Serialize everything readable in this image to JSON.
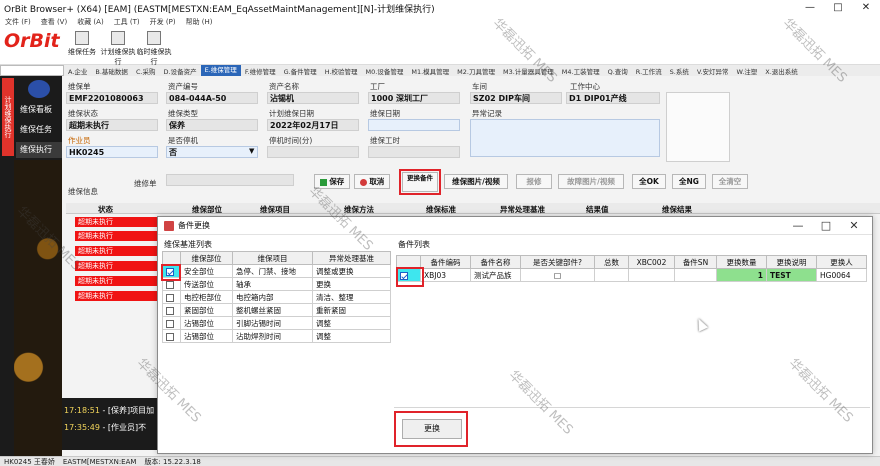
{
  "window": {
    "title": "OrBit Browser+ (X64) [EAM] (EASTM[MESTXN:EAM_EqAssetMaintManagement][N]-计划维保执行)",
    "controls": [
      "—",
      "□",
      "✕"
    ]
  },
  "menu": [
    "文件 (F)",
    "查看 (V)",
    "收藏 (A)",
    "工具 (T)",
    "开发 (P)",
    "帮助 (H)"
  ],
  "logo": "OrBit",
  "toolbar": [
    {
      "label": "维保任务",
      "icon": "task-icon"
    },
    {
      "label": "计划维保执行",
      "icon": "plan-exec-icon"
    },
    {
      "label": "临时维保执行",
      "icon": "temp-exec-icon"
    }
  ],
  "module_tabs": [
    {
      "label": "A.企业"
    },
    {
      "label": "B.基础数据"
    },
    {
      "label": "C.采购"
    },
    {
      "label": "D.设备资产"
    },
    {
      "label": "E.维保管理",
      "active": true
    },
    {
      "label": "F.维修管理"
    },
    {
      "label": "G.备件管理"
    },
    {
      "label": "H.校验管理"
    },
    {
      "label": "M0.设备管理"
    },
    {
      "label": "M1.模具管理"
    },
    {
      "label": "M2.刀具管理"
    },
    {
      "label": "M3.计量器具管理"
    },
    {
      "label": "M4.工装管理"
    },
    {
      "label": "Q.查询"
    },
    {
      "label": "R.工作流"
    },
    {
      "label": "S.系统"
    },
    {
      "label": "V.安灯异常"
    },
    {
      "label": "W.注塑"
    },
    {
      "label": "X.退出系统"
    }
  ],
  "sidebar": {
    "vertical_tab": "计划维保执行",
    "items": [
      {
        "label": "维保看板"
      },
      {
        "label": "维保任务"
      },
      {
        "label": "维保执行",
        "active": true
      }
    ]
  },
  "form": {
    "maint_order": {
      "label": "维保单",
      "value": "EMF2201080063"
    },
    "asset_no": {
      "label": "资产编号",
      "value": "084-044A-50"
    },
    "asset_name": {
      "label": "资产名称",
      "value": "沾锡机"
    },
    "factory": {
      "label": "工厂",
      "value": "1000 深圳工厂"
    },
    "workshop": {
      "label": "车间",
      "value": "SZ02 DIP车间"
    },
    "work_center": {
      "label": "工作中心",
      "value": "D1  DIP01产线"
    },
    "maint_status": {
      "label": "维保状态",
      "value": "超期未执行"
    },
    "maint_type": {
      "label": "维保类型",
      "value": "保养"
    },
    "plan_date": {
      "label": "计划维保日期",
      "value": "2022年02月17日"
    },
    "maint_date": {
      "label": "维保日期",
      "value": ""
    },
    "exception": {
      "label": "异常记录",
      "value": ""
    },
    "operator": {
      "label": "作业员",
      "value": "HK0245"
    },
    "stop_machine": {
      "label": "是否停机",
      "value": "否"
    },
    "stop_time": {
      "label": "停机时间(分)",
      "value": ""
    },
    "work_hours": {
      "label": "维保工时",
      "value": ""
    },
    "maint_info_label": "维保信息",
    "repair_order_label": "维修单"
  },
  "actions": [
    {
      "label": "保存",
      "icon": "save-icon"
    },
    {
      "label": "取消",
      "icon": "cancel-icon"
    },
    {
      "label": "更换备件"
    },
    {
      "label": "维保图片/视频"
    },
    {
      "label": "报修",
      "disabled": true
    },
    {
      "label": "故障图片/视频",
      "disabled": true
    },
    {
      "label": "全OK"
    },
    {
      "label": "全NG"
    },
    {
      "label": "全清空",
      "disabled": true
    }
  ],
  "main_grid": {
    "headers": [
      "状态",
      "维保部位",
      "维保项目",
      "维保方法",
      "维保标准",
      "异常处理基准",
      "结果值",
      "维保结果"
    ],
    "status_rows": [
      "超期未执行",
      "超期未执行",
      "超期未执行",
      "超期未执行",
      "超期未执行",
      "超期未执行"
    ]
  },
  "log": [
    {
      "time": "17:18:51",
      "msg": "- [保养]项目加"
    },
    {
      "time": "17:35:49",
      "msg": "- [作业员]不"
    }
  ],
  "statusbar": {
    "user": "HK0245 王春娇",
    "path": "EASTM[MESTXN:EAM",
    "version": "版本: 15.22.3.18"
  },
  "dialog": {
    "title": "备件更换",
    "left_title": "维保基准列表",
    "left_headers": [
      "维保部位",
      "维保项目",
      "异常处理基准"
    ],
    "left_rows": [
      {
        "checked": true,
        "part": "安全部位",
        "item": "急停、门禁、接地",
        "handle": "调整或更换"
      },
      {
        "checked": false,
        "part": "传送部位",
        "item": "轴承",
        "handle": "更换"
      },
      {
        "checked": false,
        "part": "电控柜部位",
        "item": "电控箱内部",
        "handle": "清洁、整理"
      },
      {
        "checked": false,
        "part": "紧固部位",
        "item": "整机螺丝紧固",
        "handle": "重新紧固"
      },
      {
        "checked": false,
        "part": "沾锡部位",
        "item": "引脚沾锡时间",
        "handle": "调整"
      },
      {
        "checked": false,
        "part": "沾锡部位",
        "item": "沾助焊剂时间",
        "handle": "调整"
      }
    ],
    "right_title": "备件列表",
    "right_headers": [
      "备件编码",
      "备件名称",
      "是否关键部件?",
      "总数",
      "XBC002",
      "备件SN",
      "更换数量",
      "更换说明",
      "更换人"
    ],
    "right_rows": [
      {
        "checked": true,
        "code": "XBJ03",
        "name": "测试产品族",
        "key": "□",
        "total": "",
        "xbc002": "",
        "sn": "",
        "qty": "1",
        "note": "TEST",
        "by": "HG0064"
      }
    ],
    "replace_button": "更换",
    "controls": [
      "—",
      "□",
      "✕"
    ]
  },
  "watermark_text": "华磊迅拓 MES",
  "colors": {
    "accent": "#2b66b8",
    "danger": "#e0232a",
    "status_red": "#f01414",
    "cyan": "#3ee6ee",
    "green": "#8ee08e"
  }
}
